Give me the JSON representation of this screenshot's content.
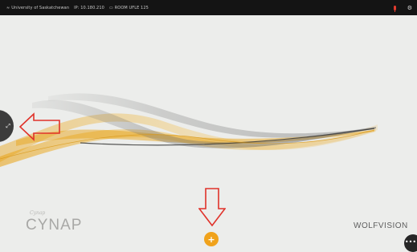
{
  "status_bar": {
    "network_label": "University of Saskatchewan",
    "ip_label": "IP: 10.180.210",
    "room_label": "ROOM  UFLE 125",
    "wifi_icon": "wifi-icon",
    "ip_icon": "network-icon",
    "room_icon": "room-icon",
    "mic_icon": "microphone-icon",
    "settings_icon": "settings-icon"
  },
  "branding": {
    "cynap_script": "Cynap",
    "cynap_word": "CYNAP",
    "wolfvision": "WOLFVISION"
  },
  "controls": {
    "add_glyph": "+",
    "more_glyph": "•••",
    "side_tab_glyph": "⤢"
  },
  "annotations": {
    "arrow_color": "#e0322a"
  },
  "colors": {
    "background": "#ecedeb",
    "status_bar": "#141414",
    "accent": "#f0a21b",
    "wave_gold": "#e8a51d",
    "wave_gray": "#8a8a8a"
  }
}
